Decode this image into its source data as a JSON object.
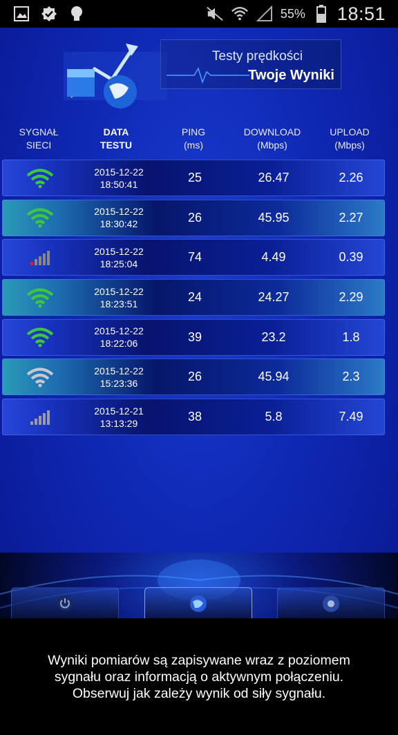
{
  "status_bar": {
    "battery": "55%",
    "time": "18:51",
    "left_icons": [
      "gallery-icon",
      "check-badge-icon",
      "lightbulb-icon"
    ],
    "right_icons": [
      "mute-icon",
      "wifi-icon",
      "cell-signal-icon",
      "battery-icon"
    ]
  },
  "banner": {
    "line1": "Testy prędkości",
    "line2": "Twoje Wyniki"
  },
  "table": {
    "headers": [
      {
        "line1": "SYGNAŁ",
        "line2": "SIECI"
      },
      {
        "line1": "DATA",
        "line2": "TESTU"
      },
      {
        "line1": "PING",
        "line2": "(ms)"
      },
      {
        "line1": "DOWNLOAD",
        "line2": "(Mbps)"
      },
      {
        "line1": "UPLOAD",
        "line2": "(Mbps)"
      }
    ],
    "rows": [
      {
        "signal": "wifi-green",
        "date": "2015-12-22",
        "time": "18:50:41",
        "ping": "25",
        "download": "26.47",
        "upload": "2.26"
      },
      {
        "signal": "wifi-green",
        "date": "2015-12-22",
        "time": "18:30:42",
        "ping": "26",
        "download": "45.95",
        "upload": "2.27"
      },
      {
        "signal": "cell-bars-low",
        "date": "2015-12-22",
        "time": "18:25:04",
        "ping": "74",
        "download": "4.49",
        "upload": "0.39"
      },
      {
        "signal": "wifi-green",
        "date": "2015-12-22",
        "time": "18:23:51",
        "ping": "24",
        "download": "24.27",
        "upload": "2.29"
      },
      {
        "signal": "wifi-green",
        "date": "2015-12-22",
        "time": "18:22:06",
        "ping": "39",
        "download": "23.2",
        "upload": "1.8"
      },
      {
        "signal": "wifi-gray",
        "date": "2015-12-22",
        "time": "15:23:36",
        "ping": "26",
        "download": "45.94",
        "upload": "2.3"
      },
      {
        "signal": "cell-bars-gray",
        "date": "2015-12-21",
        "time": "13:13:29",
        "ping": "38",
        "download": "5.8",
        "upload": "7.49"
      }
    ]
  },
  "tabs": [
    "power-icon",
    "globe-icon",
    "settings-icon"
  ],
  "toast": {
    "line1": "Wyniki pomiarów są zapisywane wraz z poziomem",
    "line2": "sygnału oraz informacją o aktywnym połączeniu.",
    "line3": "Obserwuj jak zależy wynik od siły sygnału."
  },
  "colors": {
    "wifi_green": "#3cc83c",
    "wifi_gray": "#c8c8d0",
    "signal_red": "#e02020",
    "background": "#0f28b4"
  }
}
